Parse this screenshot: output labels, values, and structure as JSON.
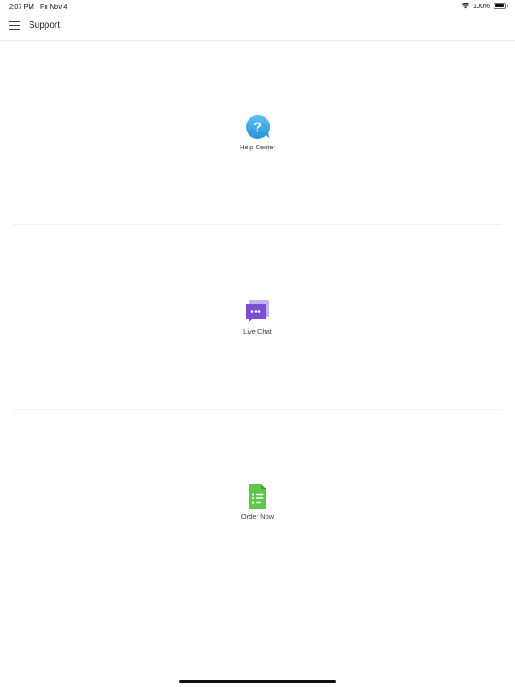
{
  "status_bar": {
    "time": "2:07 PM",
    "date": "Fri Nov 4",
    "battery": "100%",
    "icons": [
      "wifi-icon",
      "battery-icon"
    ]
  },
  "nav": {
    "title": "Support",
    "menu_icon": "hamburger-menu-icon"
  },
  "tiles": [
    {
      "label": "Help Center",
      "icon": "help-bubble-icon",
      "color": "#3aa8e8"
    },
    {
      "label": "Live Chat",
      "icon": "chat-bubble-icon",
      "color": "#7b4fd4"
    },
    {
      "label": "Order Now",
      "icon": "order-document-icon",
      "color": "#5cc94b"
    }
  ]
}
